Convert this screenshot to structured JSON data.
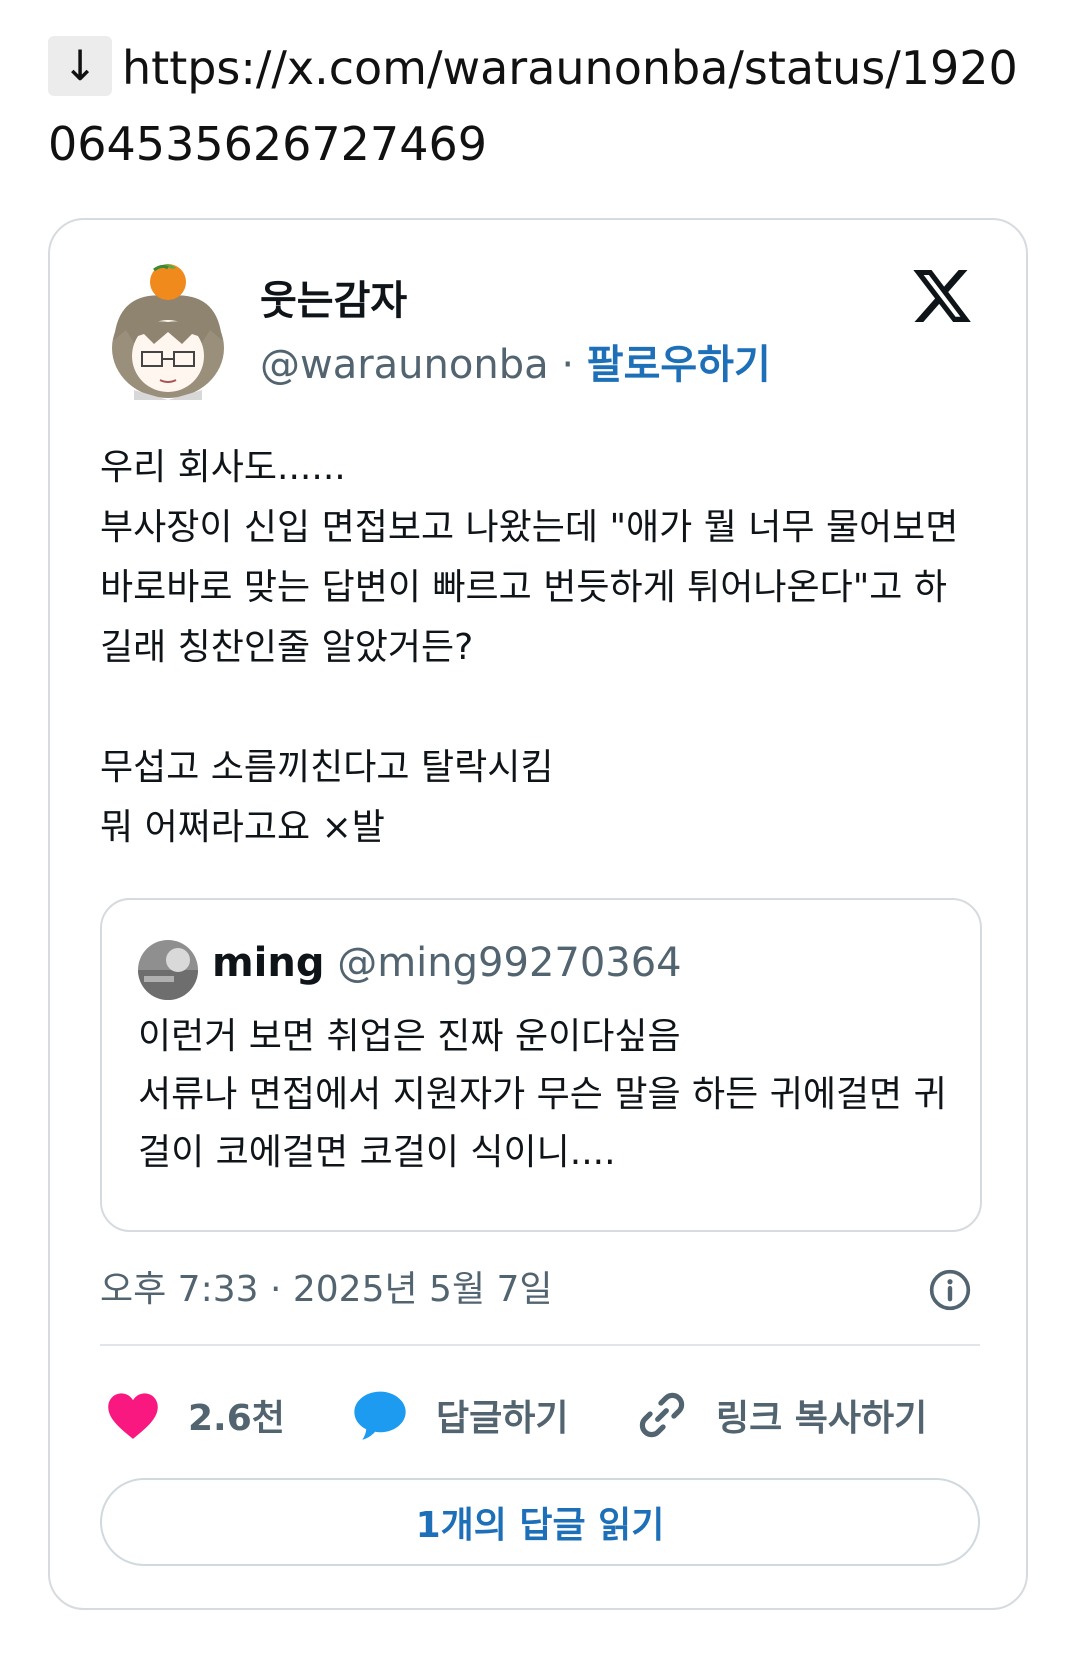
{
  "url": {
    "arrow": "↓",
    "text": "https://x.com/waraunonba/status/1920064535626727469"
  },
  "tweet": {
    "display_name": "웃는감자",
    "handle": "@waraunonba",
    "separator": "·",
    "follow_label": "팔로우하기",
    "text": "우리 회사도......\n부사장이 신입 면접보고 나왔는데 \"애가 뭘 너무 물어보면 바로바로 맞는 답변이 빠르고 번듯하게 튀어나온다\"고 하길래 칭찬인줄 알았거든?\n\n무섭고 소름끼친다고 탈락시킴\n뭐 어쩌라고요 ×발",
    "timestamp": "오후 7:33 · 2025년 5월 7일"
  },
  "quote": {
    "name": "ming",
    "handle": "@ming99270364",
    "text": "이런거 보면 취업은 진짜 운이다싶음\n서류나 면접에서 지원자가 무슨 말을 하든 귀에걸면 귀걸이 코에걸면 코걸이 식이니...."
  },
  "actions": {
    "likes": "2.6천",
    "reply": "답글하기",
    "copy_link": "링크 복사하기"
  },
  "read_replies": "1개의 답글 읽기",
  "colors": {
    "like": "#f91880",
    "reply": "#1d9bf0",
    "link": "#1d6fb8",
    "muted": "#536471"
  },
  "icons": {
    "down": "down-arrow-icon",
    "x": "x-logo-icon",
    "info": "info-icon",
    "like": "heart-icon",
    "reply": "speech-bubble-icon",
    "copy": "link-icon"
  }
}
